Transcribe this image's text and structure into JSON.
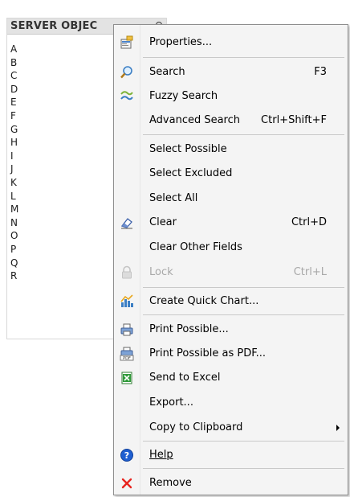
{
  "listbox": {
    "title": "SERVER OBJEC",
    "items": [
      "A",
      "B",
      "C",
      "D",
      "E",
      "F",
      "G",
      "H",
      "I",
      "J",
      "K",
      "L",
      "M",
      "N",
      "O",
      "P",
      "Q",
      "R"
    ]
  },
  "menu": {
    "properties": "Properties...",
    "search": "Search",
    "search_shortcut": "F3",
    "fuzzy_search": "Fuzzy Search",
    "advanced_search": "Advanced Search",
    "advanced_search_shortcut": "Ctrl+Shift+F",
    "select_possible": "Select Possible",
    "select_excluded": "Select Excluded",
    "select_all": "Select All",
    "clear": "Clear",
    "clear_shortcut": "Ctrl+D",
    "clear_other_fields": "Clear Other Fields",
    "lock": "Lock",
    "lock_shortcut": "Ctrl+L",
    "create_quick_chart": "Create Quick Chart...",
    "print_possible": "Print Possible...",
    "print_possible_pdf": "Print Possible as PDF...",
    "send_to_excel": "Send to Excel",
    "export": "Export...",
    "copy_to_clipboard": "Copy to Clipboard",
    "help": "Help",
    "remove": "Remove"
  },
  "colors": {
    "menu_background": "#f4f4f4",
    "disabled_text": "#a8a8a8",
    "remove_icon": "#e8241e",
    "help_icon": "#1f5fd1"
  }
}
